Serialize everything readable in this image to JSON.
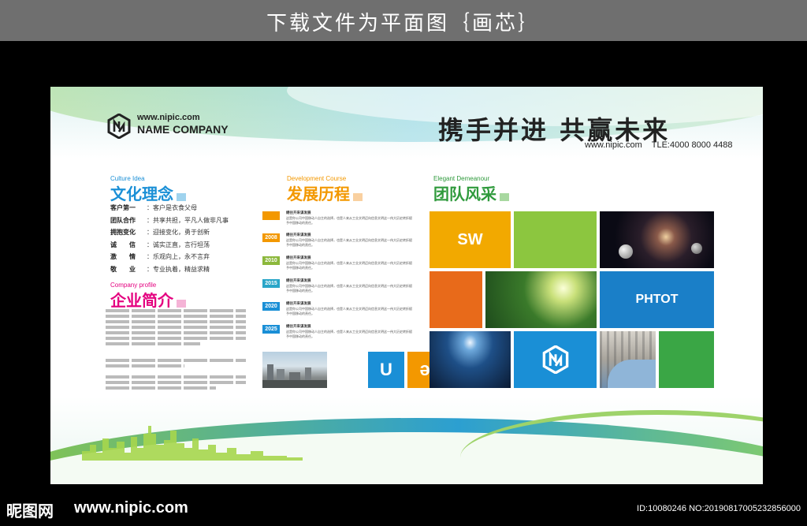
{
  "header": {
    "title": "下载文件为平面图｛画芯｝"
  },
  "board": {
    "logo_url": "www.nipic.com",
    "logo_name": "NAME COMPANY",
    "slogan": "携手并进 共赢未来",
    "contact_url": "www.nipic.com",
    "contact_tel": "TLE:4000 8000 4488"
  },
  "culture": {
    "en": "Culture Idea",
    "zh": "文化理念",
    "rows": [
      {
        "key": "客户第一",
        "value": "：客户是衣食父母"
      },
      {
        "key": "团队合作",
        "value": "：共享共担，平凡人做非凡事"
      },
      {
        "key": "拥抱变化",
        "value": "：迎接变化，勇于创新"
      },
      {
        "key": "诚　　信",
        "value": "：诚实正直，言行坦荡"
      },
      {
        "key": "激　　情",
        "value": "：乐观向上，永不言弃"
      },
      {
        "key": "敬　　业",
        "value": "：专业执着，精益求精"
      }
    ]
  },
  "company": {
    "en": "Company profile",
    "zh": "企业简介"
  },
  "development": {
    "en": "Development Course",
    "zh": "发展历程",
    "items": [
      {
        "year": "",
        "title": "继往开来谋发展",
        "text": "这是你公司中国移动人自主的选择，也是人来从工业文明迈向信息文明这一伟大历史转折赋予中国移动的责任。"
      },
      {
        "year": "2008",
        "title": "继往开来谋发展",
        "text": "这是你公司中国移动人自主的选择，也是人来从工业文明迈向信息文明这一伟大历史转折赋予中国移动的责任。"
      },
      {
        "year": "2010",
        "title": "继往开来谋发展",
        "text": "这是你公司中国移动人自主的选择，也是人来从工业文明迈向信息文明这一伟大历史转折赋予中国移动的责任。"
      },
      {
        "year": "2015",
        "title": "继往开来谋发展",
        "text": "这是你公司中国移动人自主的选择，也是人来从工业文明迈向信息文明这一伟大历史转折赋予中国移动的责任。"
      },
      {
        "year": "2020",
        "title": "继往开来谋发展",
        "text": "这是你公司中国移动人自主的选择，也是人来从工业文明迈向信息文明这一伟大历史转折赋予中国移动的责任。"
      },
      {
        "year": "2025",
        "title": "继往开来谋发展",
        "text": "这是你公司中国移动人自主的选择，也是人来从工业文明迈向信息文明这一伟大历史转折赋予中国移动的责任。"
      }
    ],
    "tile_u": "U",
    "tile_e": "ə"
  },
  "team": {
    "en": "Elegant Demeanour",
    "zh": "团队风采",
    "tile_sw": "SW",
    "tile_photo": "PHTOT"
  },
  "colors": {
    "blue": "#1a8fd6",
    "pink": "#e4007f",
    "orange": "#f39800",
    "green": "#2f9a3c",
    "lime": "#8cc63f",
    "red_orange": "#e86a1a"
  },
  "footer": {
    "logo_text": "昵图网",
    "url": "www.nipic.com",
    "id_text": "ID:10080246 NO:20190817005232856000"
  }
}
